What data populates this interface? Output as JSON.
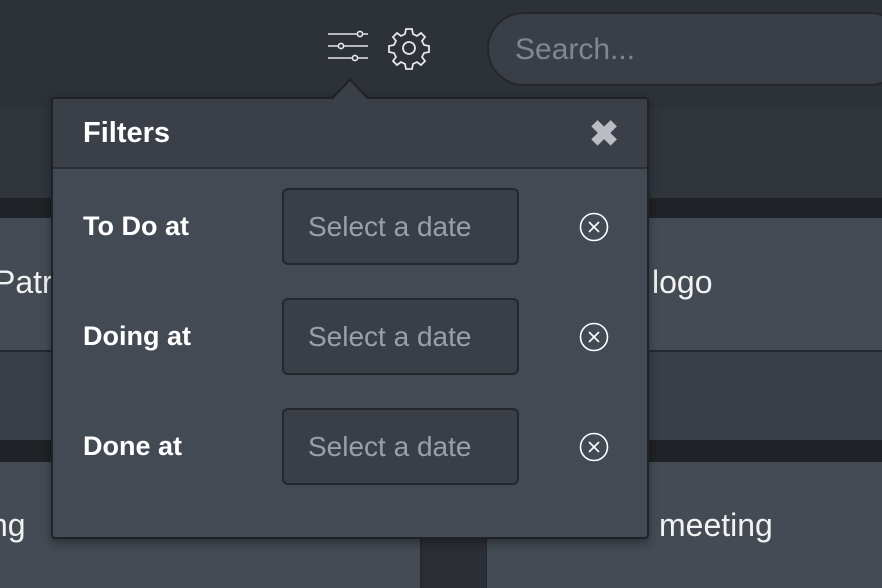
{
  "search": {
    "placeholder": "Search..."
  },
  "background_cards": {
    "row1_left": "Patr",
    "row1_right": "logo",
    "row2_left": "ng",
    "row2_right": "meeting"
  },
  "filters": {
    "title": "Filters",
    "close_glyph": "✖",
    "rows": [
      {
        "label": "To Do at",
        "placeholder": "Select a date"
      },
      {
        "label": "Doing at",
        "placeholder": "Select a date"
      },
      {
        "label": "Done at",
        "placeholder": "Select a date"
      }
    ]
  },
  "icons": {
    "filter": "sliders-icon",
    "settings": "gear-icon",
    "clear": "circle-x-icon"
  }
}
